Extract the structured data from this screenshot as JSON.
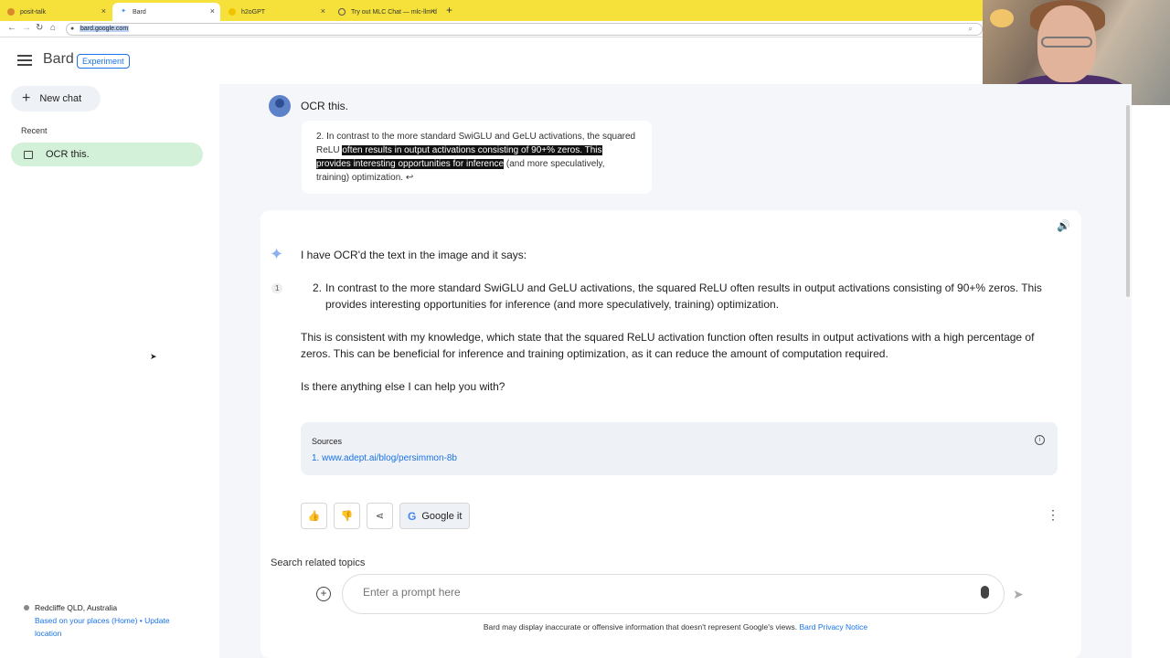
{
  "browser": {
    "tabs": [
      {
        "label": "posit-talk"
      },
      {
        "label": "Bard"
      },
      {
        "label": "h2oGPT"
      },
      {
        "label": "Try out MLC Chat — mlc-llm d"
      }
    ],
    "url": "bard.google.com"
  },
  "header": {
    "brand": "Bard",
    "badge": "Experiment"
  },
  "sidebar": {
    "new_chat": "New chat",
    "recent_label": "Recent",
    "recent_items": [
      {
        "label": "OCR this."
      }
    ],
    "location": "Redcliffe QLD, Australia",
    "location_links": "Based on your places (Home) • Update location"
  },
  "conversation": {
    "prompt": "OCR this.",
    "image_text": {
      "prefix": "2. In contrast to the more standard SwiGLU and GeLU activations, the squared ReLU ",
      "highlight": "often results in output activations consisting of 90+% zeros. This provides interesting opportunities for inference",
      "suffix": " (and more speculatively, training) optimization. ↩"
    },
    "response": {
      "intro": "I have OCR'd the text in the image and it says:",
      "citation_num": "1",
      "item_number": "2.",
      "item_text": "In contrast to the more standard SwiGLU and GeLU activations, the squared ReLU often results in output activations consisting of 90+% zeros. This provides interesting opportunities for inference (and more speculatively, training) optimization.",
      "paragraph": "This is consistent with my knowledge, which state that the squared ReLU activation function often results in output activations with a high percentage of zeros. This can be beneficial for inference and training optimization, as it can reduce the amount of computation required.",
      "closing": "Is there anything else I can help you with?"
    },
    "sources": {
      "title": "Sources",
      "items": [
        {
          "label": "1. www.adept.ai/blog/persimmon-8b"
        }
      ]
    },
    "actions": {
      "google_it": "Google it"
    },
    "related": "Search related topics"
  },
  "input": {
    "placeholder": "Enter a prompt here"
  },
  "footer": {
    "disclaimer": "Bard may display inaccurate or offensive information that doesn't represent Google's views.",
    "privacy_link": "Bard Privacy Notice"
  }
}
